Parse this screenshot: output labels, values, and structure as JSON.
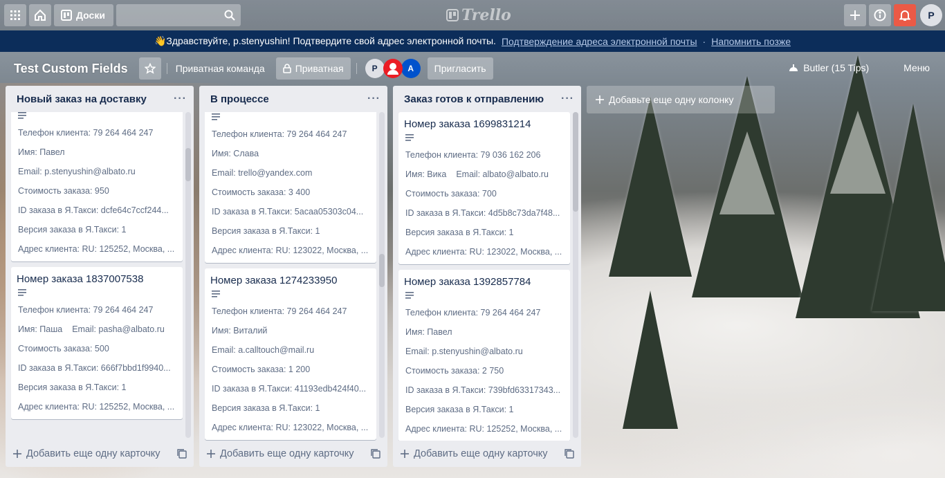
{
  "header": {
    "boards_label": "Доски",
    "search_value": "",
    "logo_text": "Trello",
    "avatar_initial": "P"
  },
  "banner": {
    "greeting": "👋Здравствуйте, p.stenyushin! Подтвердите свой адрес электронной почты.",
    "confirm_link": "Подтверждение адреса электронной почты",
    "separator": "·",
    "remind_link": "Напомнить позже"
  },
  "board": {
    "title": "Test Custom Fields",
    "team": "Приватная команда",
    "visibility": "Приватная",
    "members": [
      "P",
      "A"
    ],
    "invite_label": "Пригласить",
    "butler_label": "Butler (15 Tips)",
    "menu_label": "Меню"
  },
  "lists": [
    {
      "title": "Новый заказ на доставку",
      "footer": "Добавить еще одну карточку",
      "cards": [
        {
          "title": "",
          "phone": "Телефон клиента: 79 264 464 247",
          "name": "Имя: Павел",
          "email": "Email: p.stenyushin@albato.ru",
          "cost": "Стоимость заказа: 950",
          "order_id": "ID заказа в Я.Такси: dcfe64c7ccf244...",
          "version": "Версия заказа в Я.Такси: 1",
          "address": "Адрес клиента: RU: 125252, Москва, ..."
        },
        {
          "title": "Номер заказа 1837007538",
          "phone": "Телефон клиента: 79 264 464 247",
          "name": "Имя: Паша",
          "email": "Email: pasha@albato.ru",
          "cost": "Стоимость заказа: 500",
          "order_id": "ID заказа в Я.Такси: 666f7bbd1f9940...",
          "version": "Версия заказа в Я.Такси: 1",
          "address": "Адрес клиента: RU: 125252, Москва, ..."
        }
      ]
    },
    {
      "title": "В процессе",
      "footer": "Добавить еще одну карточку",
      "cards": [
        {
          "title": "",
          "phone": "Телефон клиента: 79 264 464 247",
          "name": "Имя: Слава",
          "email": "Email: trello@yandex.com",
          "cost": "Стоимость заказа: 3 400",
          "order_id": "ID заказа в Я.Такси: 5acaa05303c04...",
          "version": "Версия заказа в Я.Такси: 1",
          "address": "Адрес клиента: RU: 123022, Москва, ..."
        },
        {
          "title": "Номер заказа 1274233950",
          "phone": "Телефон клиента: 79 264 464 247",
          "name": "Имя: Виталий",
          "email": "Email: a.calltouch@mail.ru",
          "cost": "Стоимость заказа: 1 200",
          "order_id": "ID заказа в Я.Такси: 41193edb424f40...",
          "version": "Версия заказа в Я.Такси: 1",
          "address": "Адрес клиента: RU: 123022, Москва, ..."
        }
      ]
    },
    {
      "title": "Заказ готов к отправлению",
      "footer": "Добавить еще одну карточку",
      "cards": [
        {
          "title": "Номер заказа 1699831214",
          "phone": "Телефон клиента: 79 036 162 206",
          "name": "Имя: Вика",
          "email": "Email: albato@albato.ru",
          "cost": "Стоимость заказа: 700",
          "order_id": "ID заказа в Я.Такси: 4d5b8c73da7f48...",
          "version": "Версия заказа в Я.Такси: 1",
          "address": "Адрес клиента: RU: 123022, Москва, ..."
        },
        {
          "title": "Номер заказа 1392857784",
          "phone": "Телефон клиента: 79 264 464 247",
          "name": "Имя: Павел",
          "email": "Email: p.stenyushin@albato.ru",
          "cost": "Стоимость заказа: 2 750",
          "order_id": "ID заказа в Я.Такси: 739bfd63317343...",
          "version": "Версия заказа в Я.Такси: 1",
          "address": "Адрес клиента: RU: 125252, Москва, ..."
        }
      ]
    }
  ],
  "add_list_label": "Добавьте еще одну колонку",
  "colors": {
    "banner_bg": "#0c2d5a",
    "list_bg": "#ebecf0",
    "bell_bg": "#eb5a46",
    "member_a_bg": "#0052cc",
    "member_red_bg": "#eb1c24"
  }
}
